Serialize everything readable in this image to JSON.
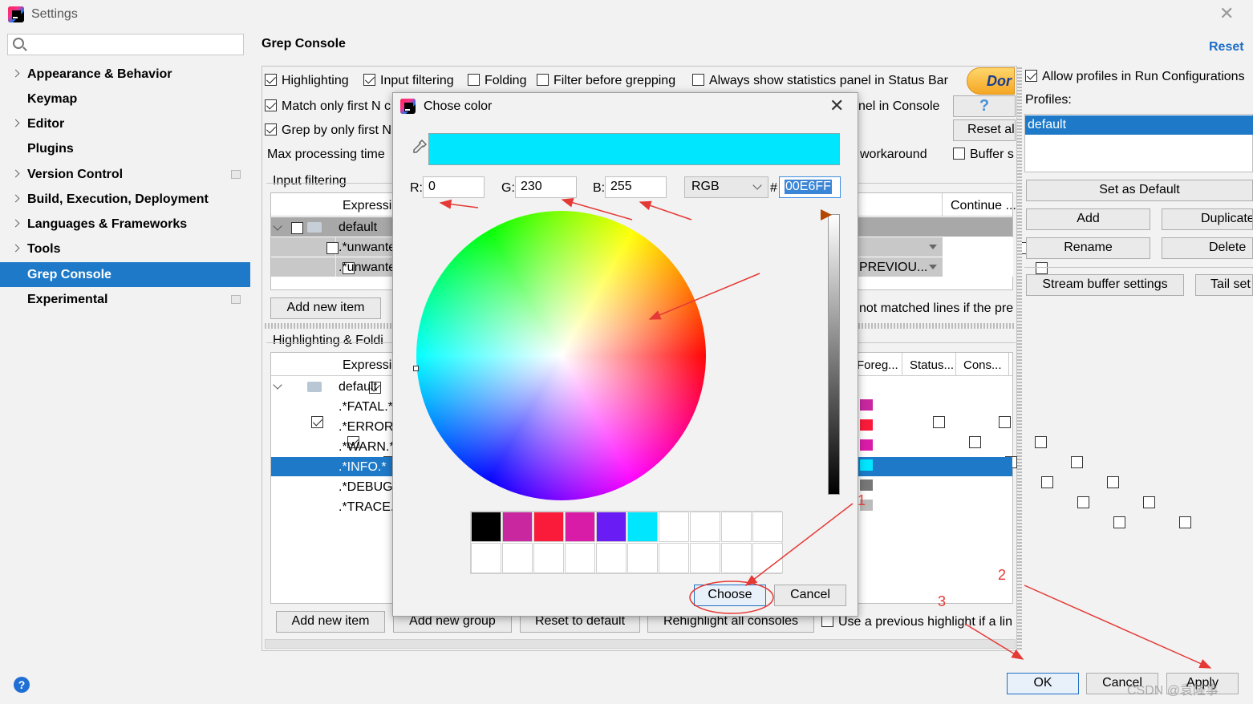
{
  "window": {
    "title": "Settings"
  },
  "sidebar": {
    "search_placeholder": "",
    "items": [
      {
        "label": "Appearance & Behavior",
        "expandable": true,
        "project": false
      },
      {
        "label": "Keymap",
        "expandable": false,
        "project": false
      },
      {
        "label": "Editor",
        "expandable": true,
        "project": false
      },
      {
        "label": "Plugins",
        "expandable": false,
        "project": false
      },
      {
        "label": "Version Control",
        "expandable": true,
        "project": true
      },
      {
        "label": "Build, Execution, Deployment",
        "expandable": true,
        "project": false
      },
      {
        "label": "Languages & Frameworks",
        "expandable": true,
        "project": false
      },
      {
        "label": "Tools",
        "expandable": true,
        "project": false
      },
      {
        "label": "Grep Console",
        "expandable": false,
        "project": false,
        "selected": true
      },
      {
        "label": "Experimental",
        "expandable": false,
        "project": true
      }
    ]
  },
  "main": {
    "title": "Grep Console",
    "reset_link": "Reset",
    "options": {
      "highlighting": "Highlighting",
      "input_filtering": "Input filtering",
      "folding": "Folding",
      "filter_before": "Filter before grepping",
      "always_stats": "Always show statistics panel in Status Bar",
      "match_only": "Match only first N c",
      "grep_only": "Grep by only first N",
      "max_time": "Max processing time",
      "in_console": "nel in Console",
      "workaround": "workaround",
      "buffer": "Buffer s"
    },
    "donate_label": "Dor",
    "help_label": "?",
    "reset_all_label": "Reset al",
    "input_filtering": {
      "title": "Input filtering",
      "col_expression": "Expressio",
      "col_continue": "Continue ...",
      "rows": [
        "default",
        ".*unwante",
        ".*unwante"
      ],
      "previous_text": "PREVIOU...",
      "add_item": "Add new item",
      "not_matched": "not matched lines if the pre"
    },
    "highlighting": {
      "title": "Highlighting & Foldi",
      "col_expression": "Expressio",
      "col_foreground": "Foreg...",
      "col_status": "Status...",
      "col_console": "Cons...",
      "group": "default",
      "rows": [
        {
          "expr": ".*FATAL.*",
          "color": "#c8279f"
        },
        {
          "expr": ".*ERROR.*",
          "color": "#fa1b3a"
        },
        {
          "expr": ".*WARN.*",
          "color": "#d91ca8"
        },
        {
          "expr": ".*INFO.*",
          "color": "#00e6ff"
        },
        {
          "expr": ".*DEBUG.*",
          "color": "#777777"
        },
        {
          "expr": ".*TRACE.*",
          "color": "#bbbbbb"
        }
      ],
      "add_item": "Add new item",
      "add_group": "Add new group",
      "reset_default": "Reset to default",
      "rehighlight": "Rehighlight all consoles",
      "use_previous": "Use a previous highlight if a lin"
    }
  },
  "profiles": {
    "allow_label": "Allow profiles in Run Configurations",
    "label": "Profiles:",
    "items": [
      "default"
    ],
    "set_default": "Set as Default",
    "add": "Add",
    "duplicate": "Duplicate",
    "rename": "Rename",
    "delete": "Delete",
    "stream_buffer": "Stream buffer settings",
    "tail": "Tail set"
  },
  "color_dialog": {
    "title": "Chose color",
    "preview_color": "#00e6ff",
    "r_label": "R:",
    "r_value": "0",
    "g_label": "G:",
    "g_value": "230",
    "b_label": "B:",
    "b_value": "255",
    "mode": "RGB",
    "hash": "#",
    "hex": "00E6FF",
    "recent_colors": [
      "#000000",
      "#c8279f",
      "#fa1b3a",
      "#d91ca8",
      "#6a1cf5",
      "#00e6ff"
    ],
    "choose": "Choose",
    "cancel": "Cancel"
  },
  "footer": {
    "ok": "OK",
    "cancel": "Cancel",
    "apply": "Apply",
    "watermark": "CSDN @袁隆事"
  },
  "annotations": [
    "1",
    "2",
    "3"
  ],
  "colors": {
    "accent": "#1e7ac8",
    "link": "#1e6fc7",
    "annotation": "#e53935"
  }
}
